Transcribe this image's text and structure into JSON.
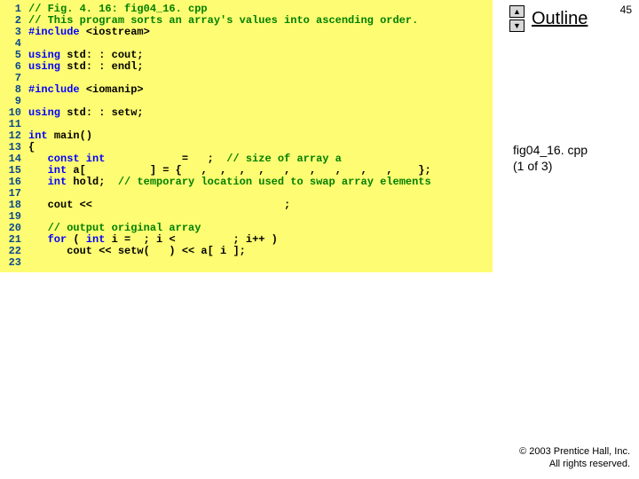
{
  "page": {
    "number": "45"
  },
  "outline": {
    "up": "▲",
    "down": "▼",
    "title": "Outline"
  },
  "side": {
    "line1": "fig04_16. cpp",
    "line2": "(1 of 3)"
  },
  "copyright": {
    "line1": "© 2003 Prentice Hall, Inc.",
    "line2": "All rights reserved."
  },
  "code": {
    "l1": {
      "n": "1",
      "a": "// Fig. 4. 16: fig04_16. cpp"
    },
    "l2": {
      "n": "2",
      "a": "// This program sorts an array's values into ascending order."
    },
    "l3": {
      "n": "3",
      "a": "#include ",
      "b": "<iostream>"
    },
    "l4": {
      "n": "4"
    },
    "l5": {
      "n": "5",
      "a": "using ",
      "b": "std: : cout;"
    },
    "l6": {
      "n": "6",
      "a": "using ",
      "b": "std: : endl;"
    },
    "l7": {
      "n": "7"
    },
    "l8": {
      "n": "8",
      "a": "#include ",
      "b": "<iomanip>"
    },
    "l9": {
      "n": "9"
    },
    "l10": {
      "n": "10",
      "a": "using ",
      "b": "std: : setw;"
    },
    "l11": {
      "n": "11"
    },
    "l12": {
      "n": "12",
      "a": "int ",
      "b": "main()"
    },
    "l13": {
      "n": "13",
      "a": "{"
    },
    "l14": {
      "n": "14",
      "a": "   const int            ",
      "b": "=   ;  ",
      "c": "// size of array a"
    },
    "l15": {
      "n": "15",
      "a": "   int ",
      "b": "a[          ] = {   ,  ,  ,  ,   ,   ,   ,   ,   ,    };"
    },
    "l16": {
      "n": "16",
      "a": "   int ",
      "b": "hold;  ",
      "c": "// temporary location used to swap array elements"
    },
    "l17": {
      "n": "17"
    },
    "l18": {
      "n": "18",
      "a": "   cout <<                              ;"
    },
    "l19": {
      "n": "19"
    },
    "l20": {
      "n": "20",
      "a": "   // output original array"
    },
    "l21": {
      "n": "21",
      "a": "   for ",
      "b": "( ",
      "c": "int ",
      "d": "i =  ; i <         ; i++ )"
    },
    "l22": {
      "n": "22",
      "a": "      cout << setw(   ) << a[ i ];"
    },
    "l23": {
      "n": "23"
    }
  }
}
